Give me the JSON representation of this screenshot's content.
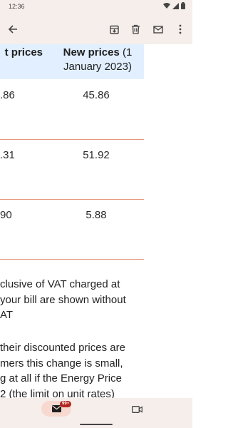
{
  "status_bar": {
    "time": "12:36",
    "icons": [
      "wifi-icon",
      "signal-icon",
      "battery-icon"
    ]
  },
  "app_bar": {
    "icons": [
      "back-arrow-icon",
      "archive-icon",
      "trash-icon",
      "mail-icon",
      "more-vert-icon"
    ]
  },
  "table": {
    "headers": {
      "old_prices": "t prices",
      "new_prices_bold": "New prices",
      "new_prices_rest_1": " (1",
      "new_prices_rest_2": "January 2023)"
    },
    "rows": [
      {
        "old": ".86",
        "new": "45.86"
      },
      {
        "old": ".31",
        "new": "51.92"
      },
      {
        "old": "90",
        "new": "5.88"
      }
    ],
    "row_divider_color": "#e8947a",
    "header_background": "#e2efff"
  },
  "body_text": {
    "para1": [
      "clusive of VAT charged at",
      " your bill are shown without",
      "AT"
    ],
    "para2": [
      "their discounted prices are",
      "mers this change is small,",
      "g at all if the Energy Price",
      "2 (the limit on unit rates)"
    ]
  },
  "bottom_nav": {
    "mail_badge": "99+",
    "mail_icon": "mail-icon",
    "meet_icon": "video-icon"
  },
  "colors": {
    "chrome": "#f6eeeb",
    "badge": "#b3261e",
    "active_pill": "#f7d9cf"
  }
}
